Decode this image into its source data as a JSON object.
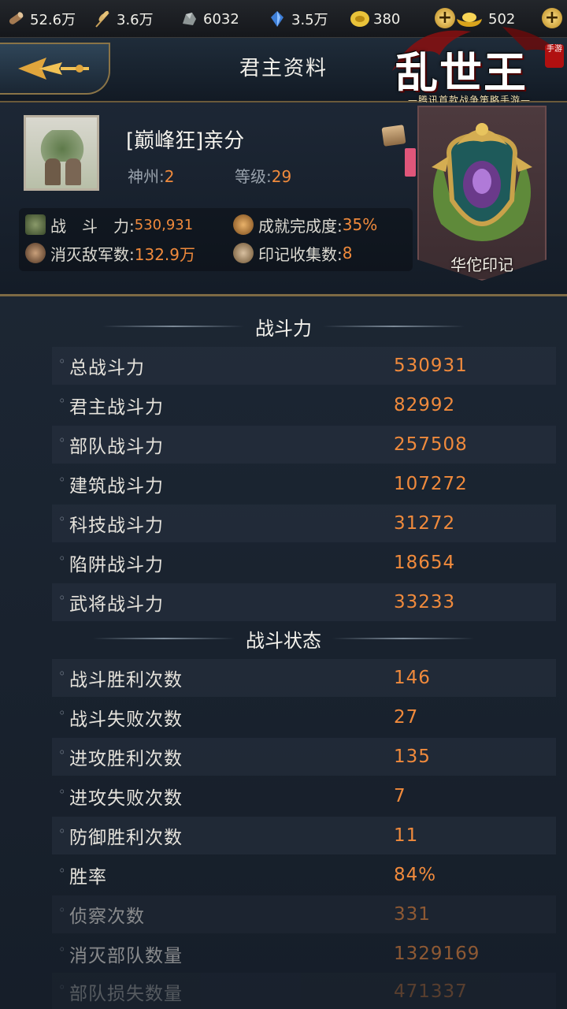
{
  "resources": [
    {
      "name": "wood",
      "value": "52.6万",
      "icon": "wood-icon"
    },
    {
      "name": "grain",
      "value": "3.6万",
      "icon": "wheat-icon"
    },
    {
      "name": "stone",
      "value": "6032",
      "icon": "stone-icon"
    },
    {
      "name": "iron",
      "value": "3.5万",
      "icon": "crystal-icon"
    },
    {
      "name": "coin",
      "value": "380",
      "icon": "coin-icon"
    },
    {
      "name": "gold",
      "value": "502",
      "icon": "gold-ingot-icon"
    }
  ],
  "header": {
    "title": "君主资料"
  },
  "logo": {
    "main": "乱世王者",
    "sub": "—腾讯首款战争策略手游—",
    "tag": "手游"
  },
  "profile": {
    "name": "[巅峰狂]亲分",
    "region_label": "神州:",
    "region_value": "2",
    "level_label": "等级:",
    "level_value": "29",
    "combat_label": "战　斗　力:",
    "combat_value": "530,931",
    "achieve_label": "成就完成度:",
    "achieve_value": "35%",
    "kills_label": "消灭敌军数:",
    "kills_value": "132.9万",
    "marks_label": "印记收集数:",
    "marks_value": "8",
    "emblem_name": "华佗印记"
  },
  "sections": {
    "power": {
      "title": "战斗力",
      "rows": [
        {
          "label": "总战斗力",
          "value": "530931"
        },
        {
          "label": "君主战斗力",
          "value": "82992"
        },
        {
          "label": "部队战斗力",
          "value": "257508"
        },
        {
          "label": "建筑战斗力",
          "value": "107272"
        },
        {
          "label": "科技战斗力",
          "value": "31272"
        },
        {
          "label": "陷阱战斗力",
          "value": "18654"
        },
        {
          "label": "武将战斗力",
          "value": "33233"
        }
      ]
    },
    "battle": {
      "title": "战斗状态",
      "rows": [
        {
          "label": "战斗胜利次数",
          "value": "146"
        },
        {
          "label": "战斗失败次数",
          "value": "27"
        },
        {
          "label": "进攻胜利次数",
          "value": "135"
        },
        {
          "label": "进攻失败次数",
          "value": "7"
        },
        {
          "label": "防御胜利次数",
          "value": "11"
        },
        {
          "label": "胜率",
          "value": "84%"
        },
        {
          "label": "侦察次数",
          "value": "331"
        },
        {
          "label": "消灭部队数量",
          "value": "1329169"
        },
        {
          "label": "部队损失数量",
          "value": "471337"
        }
      ]
    }
  },
  "colors": {
    "accent": "#f08a3c",
    "gold_border": "#7d6a44",
    "background": "#161e29"
  }
}
